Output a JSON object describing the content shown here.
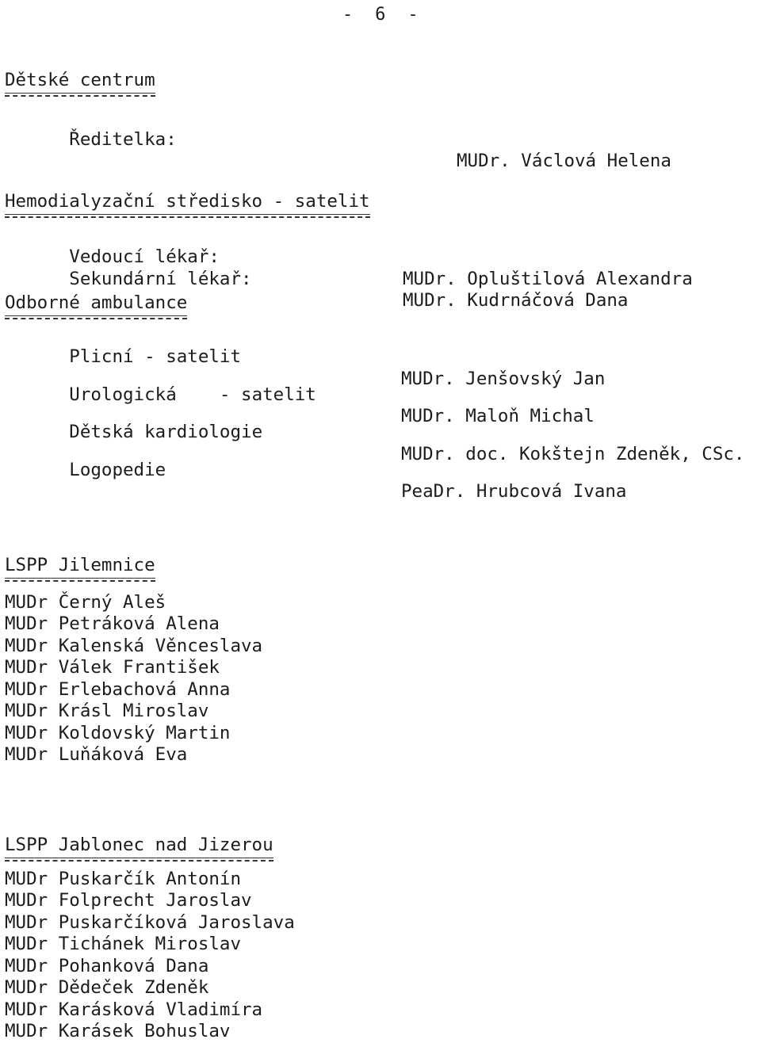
{
  "page": {
    "page_number_line": "-  6  -"
  },
  "sections": [
    {
      "heading": "Dětské centrum",
      "rows": [
        {
          "label": "Ředitelka:",
          "value": "MUDr. Václová Helena"
        }
      ]
    },
    {
      "heading": "Hemodialyzační středisko - satelit",
      "rows": [
        {
          "label": "Vedoucí lékař:",
          "value": "MUDr. Opluštilová Alexandra"
        },
        {
          "label": "Sekundární lékař:",
          "value": "MUDr. Kudrnáčová Dana"
        }
      ]
    },
    {
      "heading": "Odborné ambulance",
      "rows": [
        {
          "label": "Plicní - satelit",
          "value": "MUDr. Jenšovský Jan"
        },
        {
          "label": "Urologická    - satelit",
          "value": "MUDr. Maloň Michal"
        },
        {
          "label": "Dětská kardiologie",
          "value": "MUDr. doc. Kokštejn Zdeněk, CSc."
        },
        {
          "label": "Logopedie",
          "value": "PeaDr. Hrubcová Ivana"
        }
      ]
    },
    {
      "heading": "LSPP Jilemnice",
      "entries": [
        "MUDr Černý Aleš",
        "MUDr Petráková Alena",
        "MUDr Kalenská Věnceslava",
        "MUDr Válek František",
        "MUDr Erlebachová Anna",
        "MUDr Krásl Miroslav",
        "MUDr Koldovský Martin",
        "MUDr Luňáková Eva"
      ]
    },
    {
      "heading": "LSPP Jablonec nad Jizerou",
      "entries": [
        "MUDr Puskarčík Antonín",
        "MUDr Folprecht Jaroslav",
        "MUDr Puskarčíková Jaroslava",
        "MUDr Tichánek Miroslav",
        "MUDr Pohanková Dana",
        "MUDr Dědeček Zdeněk",
        "MUDr Karásková Vladimíra",
        "MUDr Karásek Bohuslav"
      ]
    }
  ]
}
